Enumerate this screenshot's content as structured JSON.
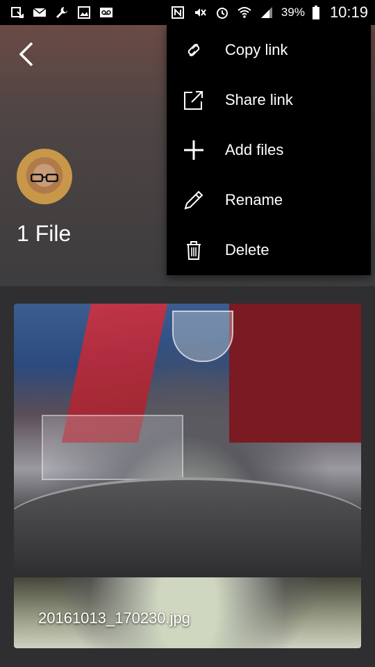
{
  "status_bar": {
    "left_icons": [
      "download-icon",
      "email-icon",
      "wrench-icon",
      "image-icon",
      "voicemail-icon"
    ],
    "right_icons": [
      "nfc-icon",
      "mute-icon",
      "alarm-icon",
      "wifi-icon",
      "signal-icon",
      "battery-icon"
    ],
    "battery_pct": "39%",
    "time": "10:19"
  },
  "header": {
    "back_icon": "chevron-left-icon",
    "file_count": "1 File"
  },
  "menu": {
    "items": [
      {
        "label": "Copy link",
        "icon": "link-icon"
      },
      {
        "label": "Share link",
        "icon": "share-icon"
      },
      {
        "label": "Add files",
        "icon": "plus-icon"
      },
      {
        "label": "Rename",
        "icon": "pencil-icon"
      },
      {
        "label": "Delete",
        "icon": "trash-icon"
      }
    ]
  },
  "files": [
    {
      "name": "20161013_170230.jpg"
    }
  ]
}
